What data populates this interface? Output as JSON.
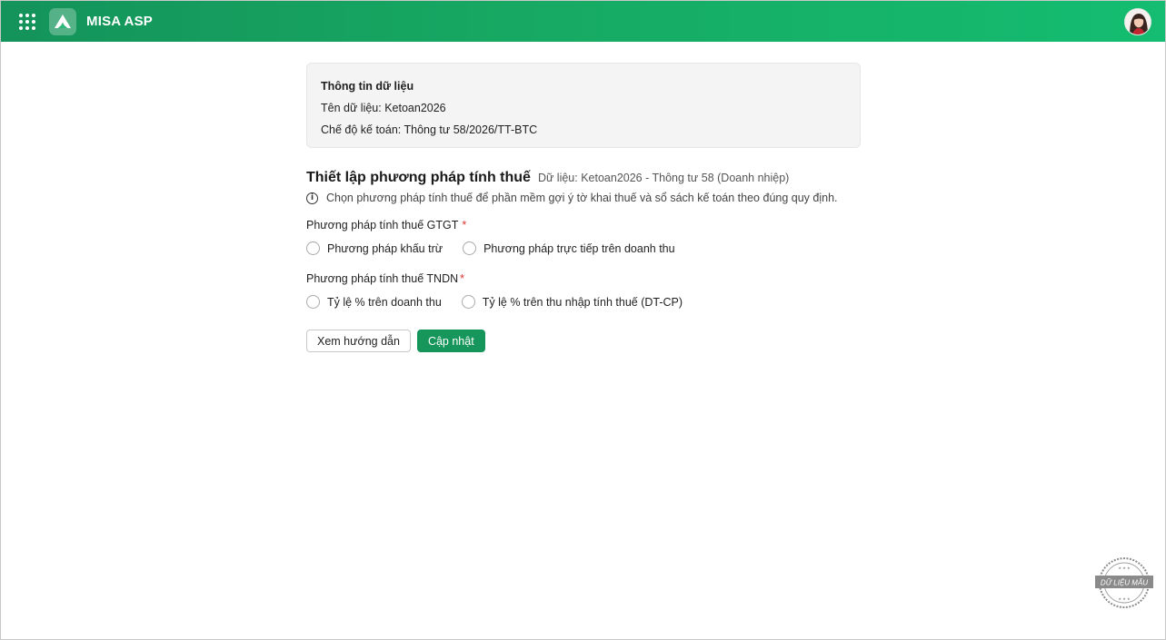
{
  "app": {
    "name": "MISA ASP"
  },
  "info_card": {
    "title": "Thông tin dữ liệu",
    "name_line": "Tên dữ liệu: Ketoan2026",
    "regime_line": "Chế độ kế toán: Thông tư 58/2026/TT-BTC"
  },
  "section": {
    "title": "Thiết lập phương pháp tính thuế",
    "subtitle": "Dữ liệu: Ketoan2026 - Thông tư 58 (Doanh nhiệp)",
    "hint": "Chọn phương pháp tính thuế để phần mềm gợi ý tờ khai thuế và sổ sách kế toán theo đúng quy định."
  },
  "vat": {
    "label": "Phương pháp tính thuế GTGT",
    "required_mark": "*",
    "options": [
      "Phương pháp khấu trừ",
      "Phương pháp trực tiếp trên doanh thu"
    ]
  },
  "cit": {
    "label": "Phương pháp tính thuế TNDN",
    "required_mark": "*",
    "options": [
      "Tỷ lệ % trên doanh thu",
      "Tỷ lệ % trên thu nhập tính thuế (DT-CP)"
    ]
  },
  "actions": {
    "guide_label": "Xem hướng dẫn",
    "update_label": "Cập nhật"
  },
  "stamp": {
    "text": "DỮ LIỆU MẪU"
  },
  "icons": {
    "apps": "apps-grid-icon",
    "logo": "misa-logo-icon",
    "info": "info-circle-icon"
  },
  "colors": {
    "brand": "#16965a",
    "header_gradient_start": "#14935a",
    "header_gradient_end": "#14bd71",
    "required": "#e0312e"
  }
}
